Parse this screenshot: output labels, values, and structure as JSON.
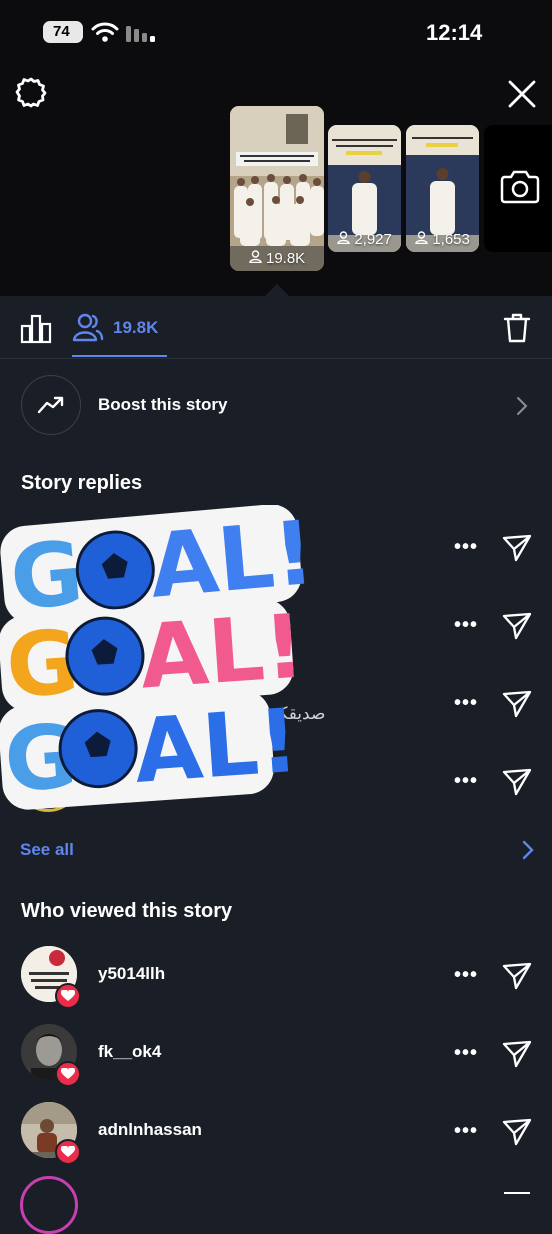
{
  "status_bar": {
    "battery": "74",
    "time": "12:14"
  },
  "stories": [
    {
      "viewers": "19.8K"
    },
    {
      "viewers": "2,927"
    },
    {
      "viewers": "1,653"
    }
  ],
  "tabs": {
    "viewers_count": "19.8K"
  },
  "boost": {
    "label": "Boost this story"
  },
  "replies": {
    "title": "Story replies",
    "arabic_text": "صديقكم",
    "see_all": "See all"
  },
  "stickers": {
    "text": "GOAL!"
  },
  "viewers": {
    "title": "Who viewed this story",
    "items": [
      {
        "username": "y5014llh"
      },
      {
        "username": "fk__ok4"
      },
      {
        "username": "adnlnhassan"
      }
    ]
  },
  "colors": {
    "accent": "#5f86ec",
    "heart": "#ec2d4a",
    "background": "#1a1e26"
  }
}
